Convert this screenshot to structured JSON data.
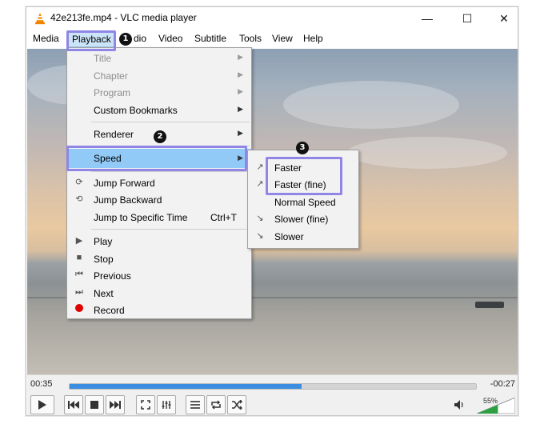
{
  "window": {
    "title": "42e213fe.mp4 - VLC media player"
  },
  "controls_window": {
    "minimize": "—",
    "maximize": "☐",
    "close": "✕"
  },
  "menubar": {
    "items": [
      "Media",
      "Playback",
      "Audio",
      "Video",
      "Subtitle",
      "Tools",
      "View",
      "Help"
    ],
    "active": "Playback",
    "visible_audio_fragment": "dio"
  },
  "playback_menu": {
    "items": [
      {
        "label": "Title",
        "disabled": true,
        "submenu": true
      },
      {
        "label": "Chapter",
        "disabled": true,
        "submenu": true
      },
      {
        "label": "Program",
        "disabled": true,
        "submenu": true
      },
      {
        "label": "Custom Bookmarks",
        "submenu": true
      },
      {
        "label": "Renderer",
        "submenu": true
      },
      {
        "label": "Speed",
        "submenu": true,
        "selected": true
      },
      {
        "label": "Jump Forward",
        "icon": "jump-forward-icon"
      },
      {
        "label": "Jump Backward",
        "icon": "jump-backward-icon"
      },
      {
        "label": "Jump to Specific Time",
        "shortcut": "Ctrl+T"
      },
      {
        "label": "Play",
        "icon": "play-icon"
      },
      {
        "label": "Stop",
        "icon": "stop-icon"
      },
      {
        "label": "Previous",
        "icon": "previous-icon"
      },
      {
        "label": "Next",
        "icon": "next-icon"
      },
      {
        "label": "Record",
        "icon": "record-icon"
      }
    ]
  },
  "speed_menu": {
    "items": [
      {
        "label": "Faster",
        "icon": "faster-icon"
      },
      {
        "label": "Faster (fine)",
        "icon": "faster-fine-icon"
      },
      {
        "label": "Normal Speed"
      },
      {
        "label": "Slower (fine)",
        "icon": "slower-fine-icon"
      },
      {
        "label": "Slower",
        "icon": "slower-icon"
      }
    ]
  },
  "badges": [
    "1",
    "2",
    "3"
  ],
  "player": {
    "time_elapsed": "00:35",
    "time_remaining": "-00:27",
    "progress": 0.57,
    "volume_label": "55%",
    "volume": 0.55
  },
  "colors": {
    "highlight": "#8f86e6",
    "seek_fill": "#3c8ee0",
    "menu_selected": "#91c9f7",
    "record": "#e00000",
    "volume_fill": "#2ea043"
  }
}
